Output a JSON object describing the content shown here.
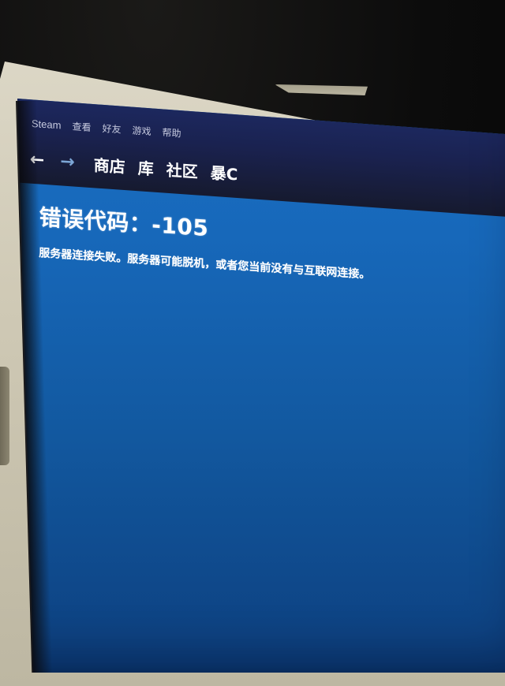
{
  "app": {
    "name": "Steam",
    "colors": {
      "topbar": "#1a2250",
      "content_bg": "#1768ba",
      "text": "#ffffff",
      "menu_text": "#c7cbe0",
      "forward_arrow": "#7ca6d6",
      "bezel": "#d6d1bf"
    }
  },
  "menu": {
    "items": [
      {
        "label": "Steam"
      },
      {
        "label": "查看"
      },
      {
        "label": "好友"
      },
      {
        "label": "游戏"
      },
      {
        "label": "帮助"
      }
    ]
  },
  "nav": {
    "back_icon": "←",
    "forward_icon": "→",
    "tabs": [
      {
        "label": "商店"
      },
      {
        "label": "库"
      },
      {
        "label": "社区"
      },
      {
        "label": "暴C"
      }
    ]
  },
  "error": {
    "title": "错误代码：-105",
    "message": "服务器连接失败。服务器可能脱机，或者您当前没有与互联网连接。"
  }
}
